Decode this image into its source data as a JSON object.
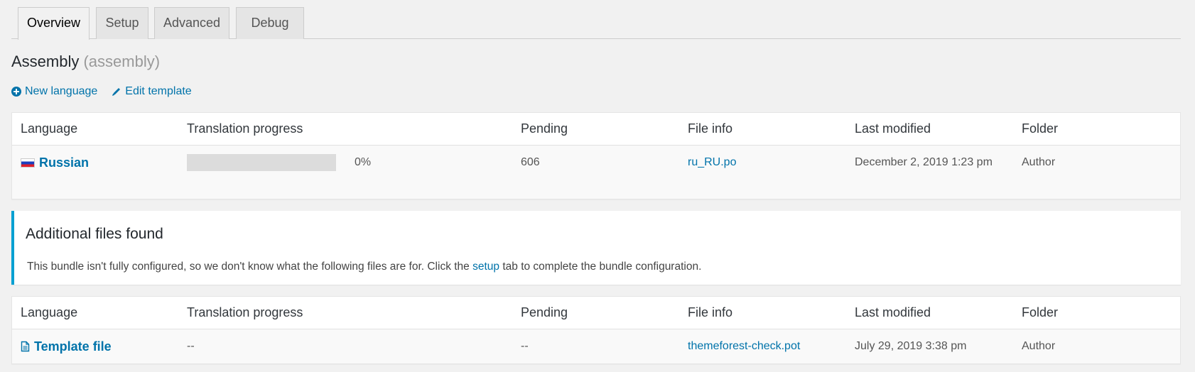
{
  "tabs": [
    {
      "label": "Overview",
      "active": true
    },
    {
      "label": "Setup",
      "active": false
    },
    {
      "label": "Advanced",
      "active": false
    },
    {
      "label": "Debug",
      "active": false
    }
  ],
  "header": {
    "title": "Assembly",
    "slug": "(assembly)"
  },
  "actions": {
    "new_language": "New language",
    "edit_template": "Edit template"
  },
  "columns": [
    "Language",
    "Translation progress",
    "Pending",
    "File info",
    "Last modified",
    "Folder"
  ],
  "languages_table": {
    "rows": [
      {
        "language": "Russian",
        "flag": "ru-flag-icon",
        "progress_percent": 0,
        "progress_label": "0%",
        "pending": "606",
        "file": "ru_RU.po",
        "modified": "December 2, 2019 1:23 pm",
        "folder": "Author"
      }
    ]
  },
  "notice": {
    "title": "Additional files found",
    "text_before": "This bundle isn't fully configured, so we don't know what the following files are for. Click the ",
    "link": "setup",
    "text_after": " tab to complete the bundle configuration.",
    "accent_color": "#00a0d2"
  },
  "additional_table": {
    "rows": [
      {
        "language": "Template file",
        "icon": "file-icon",
        "progress": "--",
        "pending": "--",
        "file": "themeforest-check.pot",
        "modified": "July 29, 2019 3:38 pm",
        "folder": "Author"
      }
    ]
  }
}
